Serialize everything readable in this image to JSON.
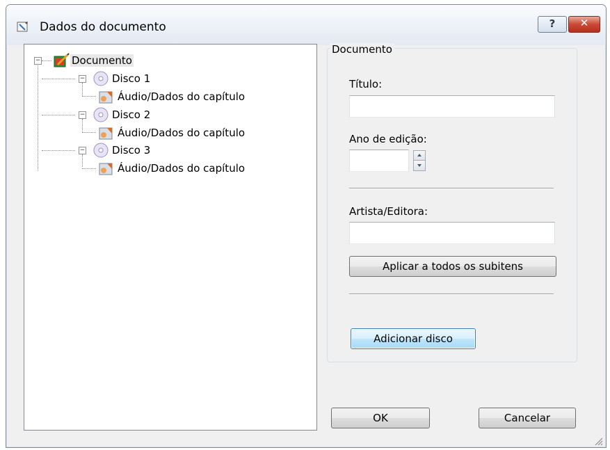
{
  "window": {
    "title": "Dados do documento",
    "help_label": "?",
    "close_label": "✕"
  },
  "tree": {
    "root": {
      "label": "Documento",
      "icon": "document-edit-icon",
      "selected": true
    },
    "discs": [
      {
        "label": "Disco 1",
        "icon": "disc-icon",
        "children": [
          {
            "label": "Áudio/Dados do capítulo",
            "icon": "audio-data-icon"
          }
        ]
      },
      {
        "label": "Disco 2",
        "icon": "disc-icon",
        "children": [
          {
            "label": "Áudio/Dados do capítulo",
            "icon": "audio-data-icon"
          }
        ]
      },
      {
        "label": "Disco 3",
        "icon": "disc-icon",
        "children": [
          {
            "label": "Áudio/Dados do capítulo",
            "icon": "audio-data-icon"
          }
        ]
      }
    ]
  },
  "panel": {
    "group_title": "Documento",
    "title_label": "Título:",
    "title_value": "",
    "year_label": "Ano de edição:",
    "year_value": "",
    "artist_label": "Artista/Editora:",
    "artist_value": "",
    "apply_all_label": "Aplicar a todos os subitens",
    "add_disc_label": "Adicionar disco"
  },
  "footer": {
    "ok_label": "OK",
    "cancel_label": "Cancelar"
  },
  "colors": {
    "dialog_bg": "#f0f0f0",
    "close_button": "#c84a36",
    "focus_button": "#3c7fb1"
  }
}
